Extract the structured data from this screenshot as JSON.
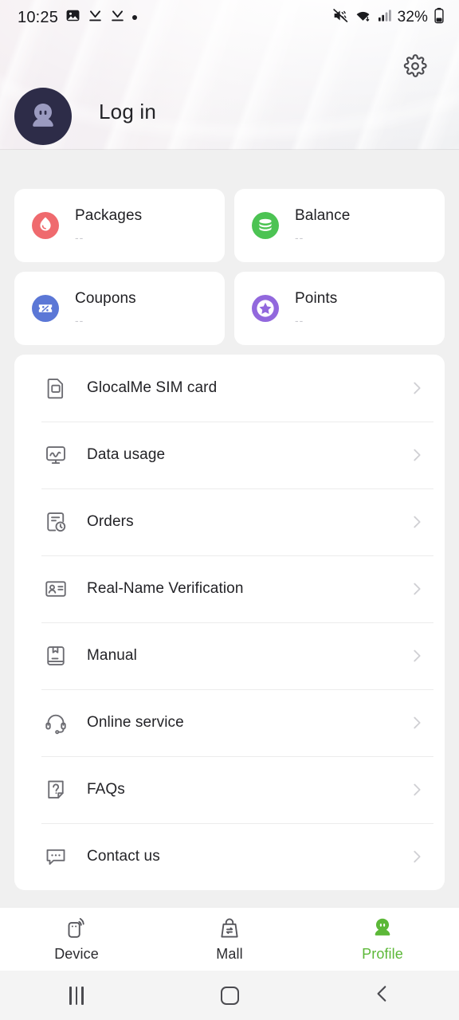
{
  "statusbar": {
    "time": "10:25",
    "left_icons": [
      "image-icon",
      "download-icon",
      "download-icon",
      "dot-icon"
    ],
    "right_icons": [
      "mute-icon",
      "wifi-icon",
      "signal-icon"
    ],
    "battery_text": "32%",
    "battery_icon": "battery-icon"
  },
  "header": {
    "settings_icon": "gear-icon",
    "avatar_icon": "avatar-placeholder-icon",
    "login_label": "Log in"
  },
  "stats": [
    {
      "title": "Packages",
      "value": "--",
      "icon": "packages-icon",
      "color": "#ef6a6e"
    },
    {
      "title": "Balance",
      "value": "--",
      "icon": "balance-icon",
      "color": "#4cc353"
    },
    {
      "title": "Coupons",
      "value": "--",
      "icon": "coupons-icon",
      "color": "#5b77d6"
    },
    {
      "title": "Points",
      "value": "--",
      "icon": "points-icon",
      "color": "#9268dd"
    }
  ],
  "menu": [
    {
      "label": "GlocalMe SIM card",
      "icon": "sim-card-icon"
    },
    {
      "label": "Data usage",
      "icon": "data-usage-icon"
    },
    {
      "label": "Orders",
      "icon": "orders-icon"
    },
    {
      "label": "Real-Name Verification",
      "icon": "id-card-icon"
    },
    {
      "label": "Manual",
      "icon": "manual-book-icon"
    },
    {
      "label": "Online service",
      "icon": "headset-icon"
    },
    {
      "label": "FAQs",
      "icon": "faq-icon"
    },
    {
      "label": "Contact us",
      "icon": "chat-bubble-icon"
    }
  ],
  "tabs": [
    {
      "label": "Device",
      "icon": "device-hotspot-icon",
      "active": false
    },
    {
      "label": "Mall",
      "icon": "shopping-bag-icon",
      "active": false
    },
    {
      "label": "Profile",
      "icon": "profile-person-icon",
      "active": true
    }
  ],
  "navbar": {
    "recents": "recents-icon",
    "home": "home-icon",
    "back": "back-icon"
  },
  "colors": {
    "accent": "#5cb838",
    "page_bg": "#f0f0f0",
    "card_bg": "#ffffff",
    "avatar_bg": "#2d2c48"
  }
}
